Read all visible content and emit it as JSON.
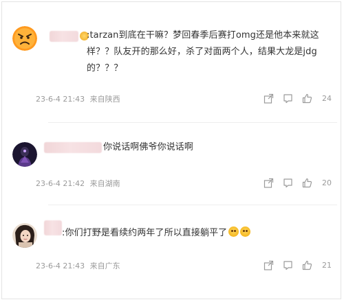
{
  "comments": [
    {
      "text": ":tarzan到底在干嘛？梦回春季后赛打omg还是他本来就这样？？队友开的那么好，杀了对面两个人，结果大龙是jdg的？？？",
      "time": "23-6-4 21:43",
      "location": "来自陕西",
      "likes": "24",
      "avatar_icon": "angry-face-avatar"
    },
    {
      "text": "你说话啊佛爷你说话啊",
      "time": "23-6-4 21:42",
      "location": "来自湖南",
      "likes": "20",
      "avatar_icon": "dark-character-avatar"
    },
    {
      "text": ":你们打野是看续约两年了所以直接躺平了",
      "time": "23-6-4 21:43",
      "location": "来自广东",
      "likes": "21",
      "avatar_icon": "girl-photo-avatar"
    }
  ],
  "icons": {
    "share": "share-icon",
    "comment": "comment-icon",
    "like": "thumbs-up-icon"
  },
  "colors": {
    "text": "#333333",
    "meta": "#9a9a9a",
    "username_blur": "#f1d6d8",
    "emoji": "#f5b822"
  }
}
